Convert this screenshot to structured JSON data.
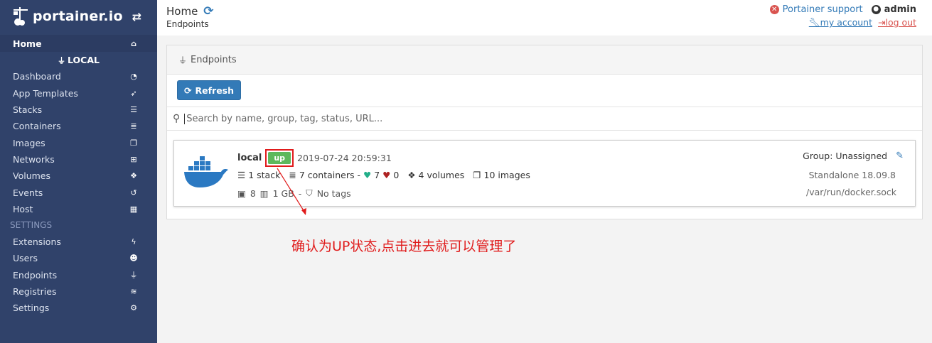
{
  "sidebar": {
    "logo_text": "portainer.io",
    "home": "Home",
    "endpoint_name": "LOCAL",
    "items": [
      {
        "label": "Dashboard",
        "icon": "tachometer-icon"
      },
      {
        "label": "App Templates",
        "icon": "rocket-icon"
      },
      {
        "label": "Stacks",
        "icon": "th-list-icon"
      },
      {
        "label": "Containers",
        "icon": "server-icon"
      },
      {
        "label": "Images",
        "icon": "clone-icon"
      },
      {
        "label": "Networks",
        "icon": "sitemap-icon"
      },
      {
        "label": "Volumes",
        "icon": "cubes-icon"
      },
      {
        "label": "Events",
        "icon": "history-icon"
      },
      {
        "label": "Host",
        "icon": "th-icon"
      }
    ],
    "settings_heading": "SETTINGS",
    "settings_items": [
      {
        "label": "Extensions",
        "icon": "bolt-icon"
      },
      {
        "label": "Users",
        "icon": "users-icon"
      },
      {
        "label": "Endpoints",
        "icon": "plug-icon"
      },
      {
        "label": "Registries",
        "icon": "database-icon"
      },
      {
        "label": "Settings",
        "icon": "cogs-icon"
      }
    ]
  },
  "header": {
    "title": "Home",
    "breadcrumb": "Endpoints",
    "support": "Portainer support",
    "user": "admin",
    "my_account": "my account",
    "log_out": "log out"
  },
  "panel": {
    "title": "Endpoints",
    "refresh_button": "Refresh",
    "search_placeholder": "Search by name, group, tag, status, URL..."
  },
  "endpoint": {
    "name": "local",
    "status": "up",
    "timestamp": "2019-07-24 20:59:31",
    "stacks": "1 stack",
    "containers": "7 containers -",
    "healthy": "7",
    "unhealthy": "0",
    "volumes": "4 volumes",
    "images": "10 images",
    "cpu": "8",
    "memory": "1 GB",
    "sep": "-",
    "tags": "No tags",
    "group": "Group: Unassigned",
    "version": "Standalone 18.09.8",
    "url": "/var/run/docker.sock"
  },
  "annotation": "确认为UP状态,点击进去就可以管理了",
  "colors": {
    "sidebar": "#30426a",
    "accent": "#337ab7",
    "up": "#5cb85c",
    "annotation": "#e01b1b"
  }
}
